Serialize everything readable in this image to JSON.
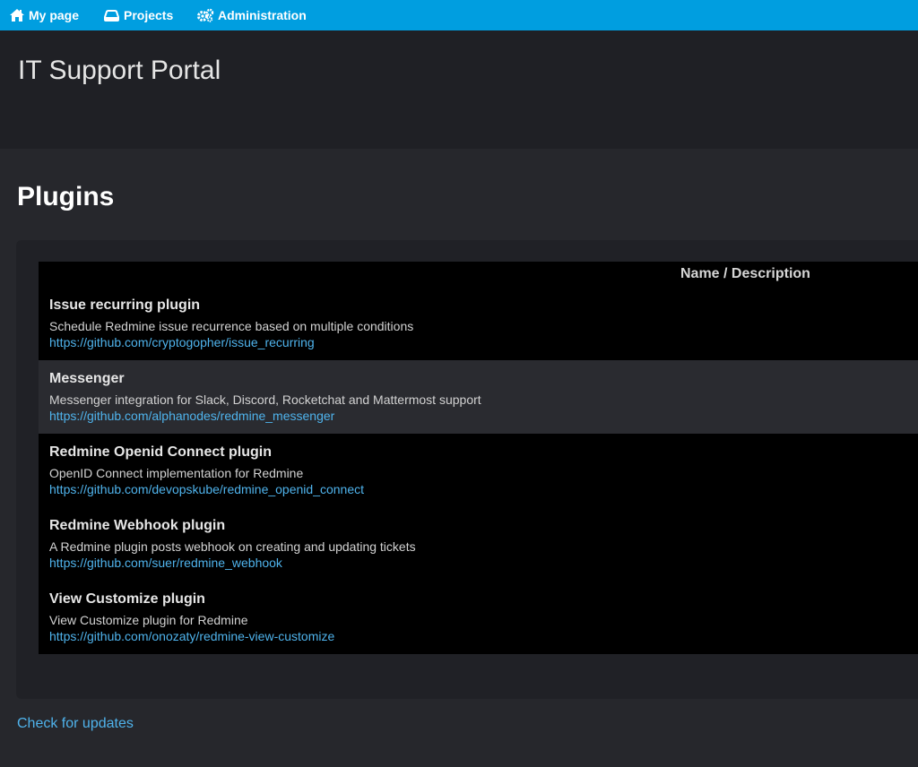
{
  "nav": {
    "my_page": "My page",
    "projects": "Projects",
    "administration": "Administration"
  },
  "header": {
    "title": "IT Support Portal"
  },
  "main": {
    "heading": "Plugins",
    "table": {
      "column_header": "Name / Description",
      "rows": [
        {
          "name": "Issue recurring plugin",
          "description": "Schedule Redmine issue recurrence based on multiple conditions",
          "url": "https://github.com/cryptogopher/issue_recurring"
        },
        {
          "name": "Messenger",
          "description": "Messenger integration for Slack, Discord, Rocketchat and Mattermost support",
          "url": "https://github.com/alphanodes/redmine_messenger"
        },
        {
          "name": "Redmine Openid Connect plugin",
          "description": "OpenID Connect implementation for Redmine",
          "url": "https://github.com/devopskube/redmine_openid_connect"
        },
        {
          "name": "Redmine Webhook plugin",
          "description": "A Redmine plugin posts webhook on creating and updating tickets",
          "url": "https://github.com/suer/redmine_webhook"
        },
        {
          "name": "View Customize plugin",
          "description": "View Customize plugin for Redmine",
          "url": "https://github.com/onozaty/redmine-view-customize"
        }
      ]
    },
    "check_updates": "Check for updates"
  },
  "colors": {
    "topbar": "#009ee0",
    "header_bg": "#1f2025",
    "page_bg": "#26272c",
    "link": "#4fb3ec"
  },
  "icons": {
    "my_page": "home-icon",
    "projects": "projects-icon",
    "administration": "gears-icon"
  }
}
